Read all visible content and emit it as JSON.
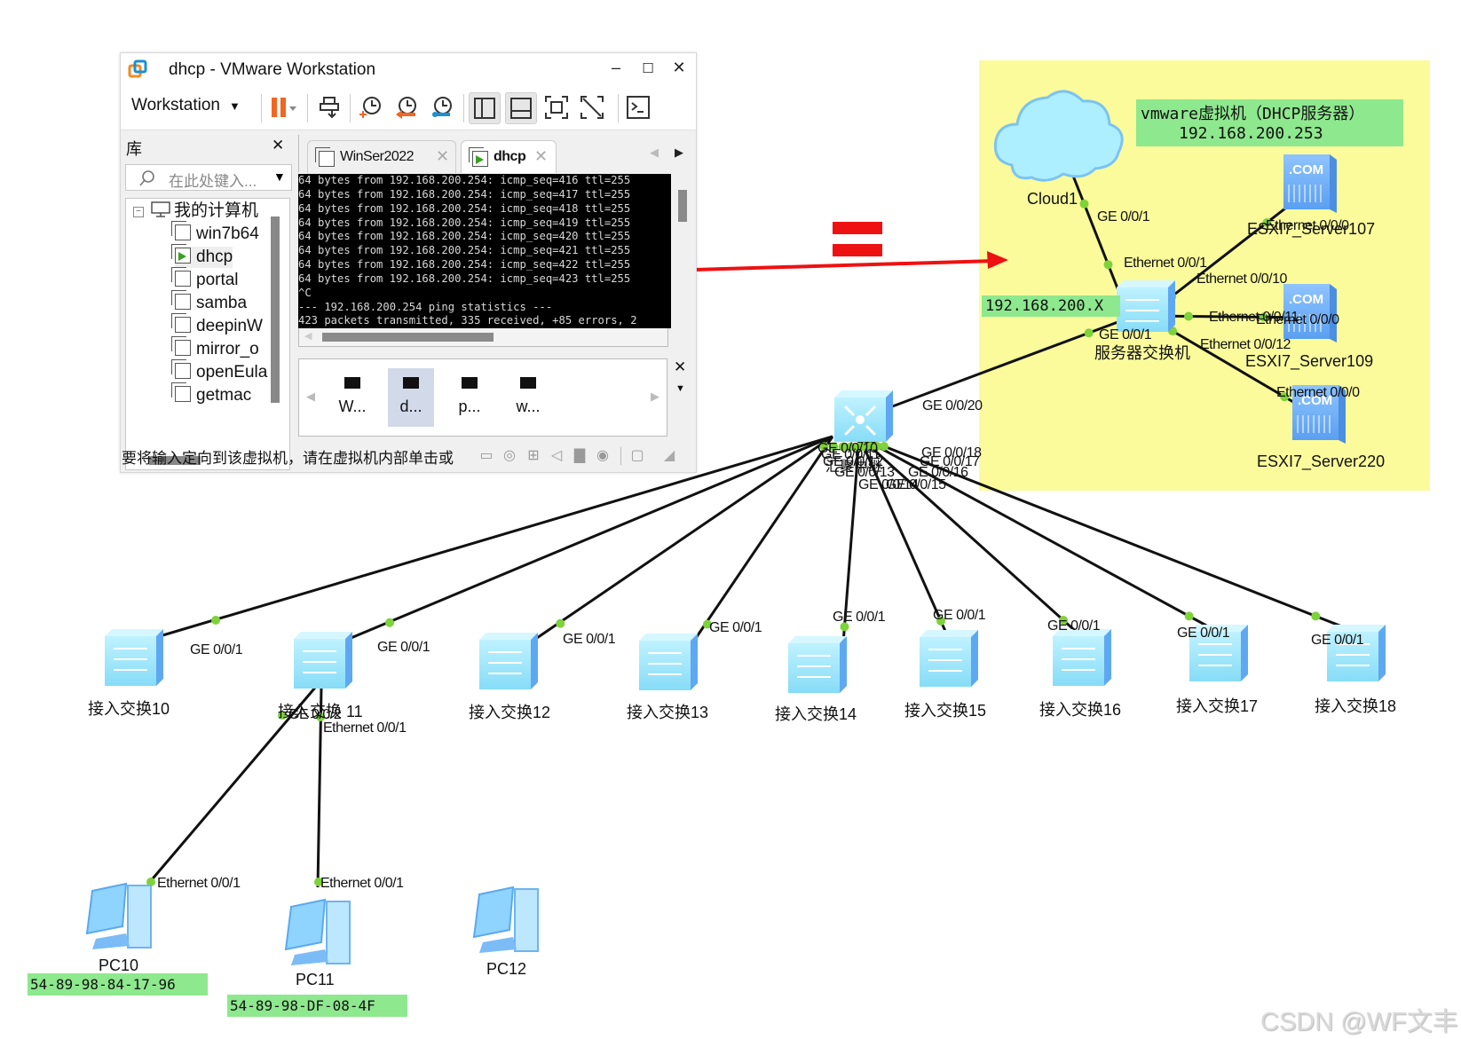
{
  "window": {
    "title": "dhcp - VMware Workstation",
    "controls": {
      "minimize": "–",
      "maximize": "☐",
      "close": "✕"
    },
    "toolbar": {
      "workstation_menu": "Workstation",
      "icons": [
        "pause-icon",
        "send-keys-icon",
        "snapshot-take-icon",
        "snapshot-revert-icon",
        "snapshot-manager-icon",
        "library-view-icon",
        "thumbnail-view-icon",
        "fullscreen-icon",
        "unity-icon",
        "console-icon"
      ]
    },
    "library": {
      "title": "库",
      "close": "✕",
      "search_placeholder": "在此处键入...",
      "root": "我的计算机",
      "items": [
        {
          "label": "win7b64",
          "running": false
        },
        {
          "label": "dhcp",
          "running": true,
          "selected": true
        },
        {
          "label": "portal",
          "running": false
        },
        {
          "label": "samba",
          "running": false
        },
        {
          "label": "deepinW",
          "running": false
        },
        {
          "label": "mirror_o",
          "running": false
        },
        {
          "label": "openEula",
          "running": false
        },
        {
          "label": "getmac",
          "running": false
        }
      ]
    },
    "tabs": [
      {
        "label": "WinSer2022",
        "active": false,
        "close": "✕"
      },
      {
        "label": "dhcp",
        "active": true,
        "close": "✕"
      }
    ],
    "console_lines": [
      "64 bytes from 192.168.200.254: icmp_seq=416 ttl=255",
      "64 bytes from 192.168.200.254: icmp_seq=417 ttl=255",
      "64 bytes from 192.168.200.254: icmp_seq=418 ttl=255",
      "64 bytes from 192.168.200.254: icmp_seq=419 ttl=255",
      "64 bytes from 192.168.200.254: icmp_seq=420 ttl=255",
      "64 bytes from 192.168.200.254: icmp_seq=421 ttl=255",
      "64 bytes from 192.168.200.254: icmp_seq=422 ttl=255",
      "64 bytes from 192.168.200.254: icmp_seq=423 ttl=255",
      "^C",
      "--- 192.168.200.254 ping statistics ---",
      "423 packets transmitted, 335 received, +85 errors, 2"
    ],
    "thumbnails": [
      {
        "label": "W...",
        "selected": false
      },
      {
        "label": "d...",
        "selected": true
      },
      {
        "label": "p...",
        "selected": false
      },
      {
        "label": "w...",
        "selected": false
      }
    ],
    "status_text": "要将输入定向到该虚拟机，请在虚拟机内部单击或",
    "status_icons": [
      "hdd-icon",
      "cd-icon",
      "network-icon",
      "sound-icon",
      "printer-icon",
      "usb-icon",
      "message-icon"
    ]
  },
  "topology": {
    "annotation_equals": "=",
    "dhcp_box": {
      "line1": "vmware虚拟机（DHCP服务器）",
      "line2": "192.168.200.253"
    },
    "subnet_box": "192.168.200.X",
    "devices": {
      "cloud": "Cloud1",
      "server_switch": "服务器交换机",
      "core_switch": "汇聚中继",
      "server107": "ESXI7_Server107",
      "server109": "ESXI7_Server109",
      "server220": "ESXI7_Server220",
      "access": [
        "接入交换10",
        "接入交换 11",
        "接入交换12",
        "接入交换13",
        "接入交换14",
        "接入交换15",
        "接入交换16",
        "接入交换17",
        "接入交换18"
      ],
      "pcs": [
        "PC10",
        "PC11",
        "PC12"
      ]
    },
    "ports": {
      "cloud_ge": "GE 0/0/1",
      "sw_eth1": "Ethernet 0/0/1",
      "sw_eth10": "Ethernet 0/0/10",
      "sw_eth11": "Ethernet 0/0/11",
      "sw_eth12": "Ethernet 0/0/12",
      "sw_ge1": "GE 0/0/1",
      "s107_eth": "Ethernet 0/0/0",
      "s109_eth": "Ethernet 0/0/0",
      "s220_eth": "Ethernet 0/0/0",
      "core_ge20": "GE 0/0/20",
      "core_ge10": "GE 0/0/10",
      "core_ge11": "GE 0/0/11",
      "core_ge12": "GE 0/0/12",
      "core_ge13": "GE 0/0/13",
      "core_ge14": "GE 0/0/14",
      "core_ge15": "GE 0/0/15",
      "core_ge16": "GE 0/0/16",
      "core_ge17": "GE 0/0/17",
      "core_ge18": "GE 0/0/18",
      "access_uplink": "GE 0/0/1",
      "a11_ge2": "GE 0/0/2",
      "a11_eth1": "Ethernet 0/0/1",
      "pc_eth": "Ethernet 0/0/1"
    },
    "mac_pc10": "54-89-98-84-17-96",
    "mac_pc11": "54-89-98-DF-08-4F"
  },
  "watermark": "CSDN @WF文丰",
  "colors": {
    "highlight_bg": "#fbfb9c",
    "label_green": "#8ee88e",
    "arrow_red": "#ee1111",
    "port_dot": "#7ed23a"
  }
}
